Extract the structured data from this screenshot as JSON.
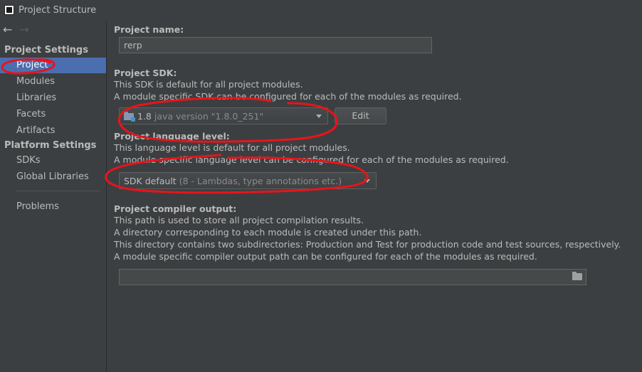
{
  "window": {
    "title": "Project Structure",
    "app_icon": "intellij-icon"
  },
  "sidebar": {
    "back_icon": "←",
    "forward_icon": "→",
    "project_settings_header": "Project Settings",
    "project_items": [
      {
        "label": "Project",
        "selected": true
      },
      {
        "label": "Modules"
      },
      {
        "label": "Libraries"
      },
      {
        "label": "Facets"
      },
      {
        "label": "Artifacts"
      }
    ],
    "platform_settings_header": "Platform Settings",
    "platform_items": [
      {
        "label": "SDKs"
      },
      {
        "label": "Global Libraries"
      }
    ],
    "problems_label": "Problems"
  },
  "project_name": {
    "label": "Project name:",
    "value": "rerp"
  },
  "project_sdk": {
    "label": "Project SDK:",
    "desc1": "This SDK is default for all project modules.",
    "desc2": "A module specific SDK can be configured for each of the modules as required.",
    "selected_version": "1.8",
    "selected_detail": "java version \"1.8.0_251\"",
    "edit_button": "Edit"
  },
  "language_level": {
    "label": "Project language level:",
    "desc1": "This language level is default for all project modules.",
    "desc2": "A module specific language level can be configured for each of the modules as required.",
    "selected_main": "SDK default",
    "selected_detail": "(8 - Lambdas, type annotations etc.)"
  },
  "compiler_output": {
    "label": "Project compiler output:",
    "desc1": "This path is used to store all project compilation results.",
    "desc2": "A directory corresponding to each module is created under this path.",
    "desc3": "This directory contains two subdirectories: Production and Test for production code and test sources, respectively.",
    "desc4": "A module specific compiler output path can be configured for each of the modules as required.",
    "value": ""
  },
  "colors": {
    "background": "#3c3f41",
    "selection": "#4b6eaf",
    "annotation": "#e8141b"
  }
}
